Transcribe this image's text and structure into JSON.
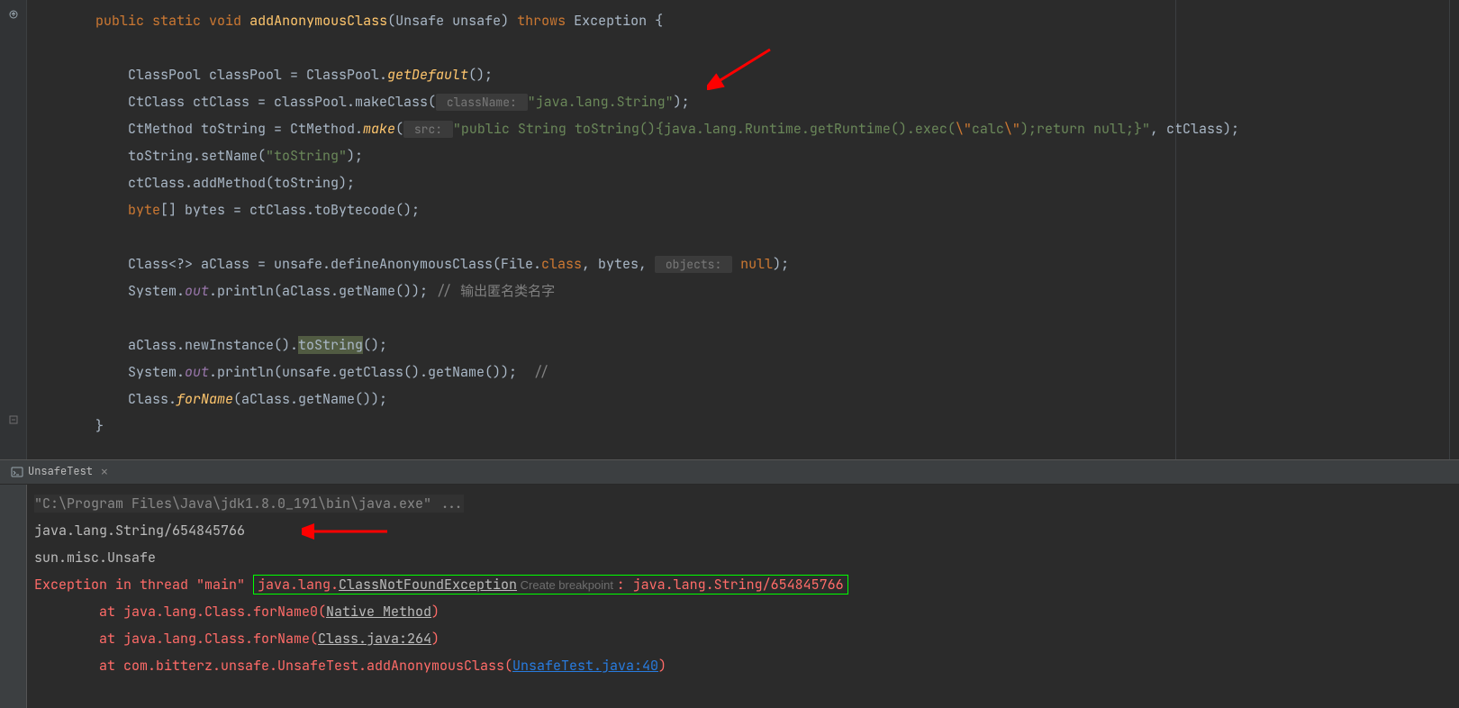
{
  "editor": {
    "lines": [
      {
        "indent": 1,
        "tokens": [
          {
            "t": "public ",
            "c": "kw"
          },
          {
            "t": "static ",
            "c": "kw"
          },
          {
            "t": "void ",
            "c": "kw"
          },
          {
            "t": "addAnonymousClass",
            "c": "method"
          },
          {
            "t": "(Unsafe unsafe) ",
            "c": ""
          },
          {
            "t": "throws ",
            "c": "kw"
          },
          {
            "t": "Exception {",
            "c": ""
          }
        ]
      },
      {
        "indent": 1,
        "tokens": []
      },
      {
        "indent": 2,
        "tokens": [
          {
            "t": "ClassPool classPool = ClassPool.",
            "c": ""
          },
          {
            "t": "getDefault",
            "c": "italic-method"
          },
          {
            "t": "();",
            "c": ""
          }
        ]
      },
      {
        "indent": 2,
        "tokens": [
          {
            "t": "CtClass ctClass = classPool.makeClass(",
            "c": ""
          },
          {
            "t": " className: ",
            "c": "param-hint"
          },
          {
            "t": "\"java.lang.String\"",
            "c": "str"
          },
          {
            "t": ");",
            "c": ""
          }
        ]
      },
      {
        "indent": 2,
        "tokens": [
          {
            "t": "CtMethod toString = CtMethod.",
            "c": ""
          },
          {
            "t": "make",
            "c": "italic-method"
          },
          {
            "t": "(",
            "c": ""
          },
          {
            "t": " src: ",
            "c": "param-hint"
          },
          {
            "t": "\"public String toString(){java.lang.Runtime.getRuntime().exec(",
            "c": "str"
          },
          {
            "t": "\\\"",
            "c": "kw"
          },
          {
            "t": "calc",
            "c": "str"
          },
          {
            "t": "\\\"",
            "c": "kw"
          },
          {
            "t": ");return null;}\"",
            "c": "str"
          },
          {
            "t": ", ctClass);",
            "c": ""
          }
        ]
      },
      {
        "indent": 2,
        "tokens": [
          {
            "t": "toString.setName(",
            "c": ""
          },
          {
            "t": "\"toString\"",
            "c": "str"
          },
          {
            "t": ");",
            "c": ""
          }
        ]
      },
      {
        "indent": 2,
        "tokens": [
          {
            "t": "ctClass.addMethod(toString);",
            "c": ""
          }
        ]
      },
      {
        "indent": 2,
        "tokens": [
          {
            "t": "byte",
            "c": "kw"
          },
          {
            "t": "[] bytes = ctClass.toBytecode();",
            "c": ""
          }
        ]
      },
      {
        "indent": 2,
        "tokens": []
      },
      {
        "indent": 2,
        "tokens": [
          {
            "t": "Class<?> aClass = unsafe.defineAnonymousClass(File.",
            "c": ""
          },
          {
            "t": "class",
            "c": "kw"
          },
          {
            "t": ", bytes, ",
            "c": ""
          },
          {
            "t": " objects: ",
            "c": "param-hint"
          },
          {
            "t": " null",
            "c": "kw"
          },
          {
            "t": ");",
            "c": ""
          }
        ]
      },
      {
        "indent": 2,
        "tokens": [
          {
            "t": "System.",
            "c": ""
          },
          {
            "t": "out",
            "c": "field"
          },
          {
            "t": ".println(aClass.getName()); ",
            "c": ""
          },
          {
            "t": "// 输出匿名类名字",
            "c": "comment"
          }
        ]
      },
      {
        "indent": 2,
        "tokens": []
      },
      {
        "indent": 2,
        "tokens": [
          {
            "t": "aClass.newInstance().",
            "c": ""
          },
          {
            "t": "toString",
            "c": "highlight-bg"
          },
          {
            "t": "();",
            "c": ""
          }
        ]
      },
      {
        "indent": 2,
        "tokens": [
          {
            "t": "System.",
            "c": ""
          },
          {
            "t": "out",
            "c": "field"
          },
          {
            "t": ".println(unsafe.getClass().getName());  ",
            "c": ""
          },
          {
            "t": "//",
            "c": "comment"
          }
        ]
      },
      {
        "indent": 2,
        "tokens": [
          {
            "t": "Class.",
            "c": ""
          },
          {
            "t": "forName",
            "c": "italic-method"
          },
          {
            "t": "(aClass.getName());",
            "c": ""
          }
        ]
      },
      {
        "indent": 1,
        "tokens": [
          {
            "t": "}",
            "c": ""
          }
        ]
      }
    ]
  },
  "console": {
    "tab_label": "UnsafeTest",
    "lines": [
      {
        "type": "exec",
        "text": "\"C:\\Program Files\\Java\\jdk1.8.0_191\\bin\\java.exe\" ..."
      },
      {
        "type": "out",
        "text": "java.lang.String/654845766"
      },
      {
        "type": "out",
        "text": "sun.misc.Unsafe"
      },
      {
        "type": "exception_main",
        "prefix": "Exception in thread \"main\" ",
        "box_pkg": "java.lang.",
        "box_class": "ClassNotFoundException",
        "breakpoint_hint": " Create breakpoint ",
        "suffix": ": java.lang.String/654845766"
      },
      {
        "type": "trace",
        "pre": "        at java.lang.Class.forName0(",
        "link": "Native Method",
        "cls": "link-underline",
        "post": ")"
      },
      {
        "type": "trace",
        "pre": "        at java.lang.Class.forName(",
        "link": "Class.java:264",
        "cls": "link-underline",
        "post": ")"
      },
      {
        "type": "trace",
        "pre": "        at com.bitterz.unsafe.UnsafeTest.addAnonymousClass(",
        "link": "UnsafeTest.java:40",
        "cls": "link-blue",
        "post": ")"
      }
    ]
  }
}
